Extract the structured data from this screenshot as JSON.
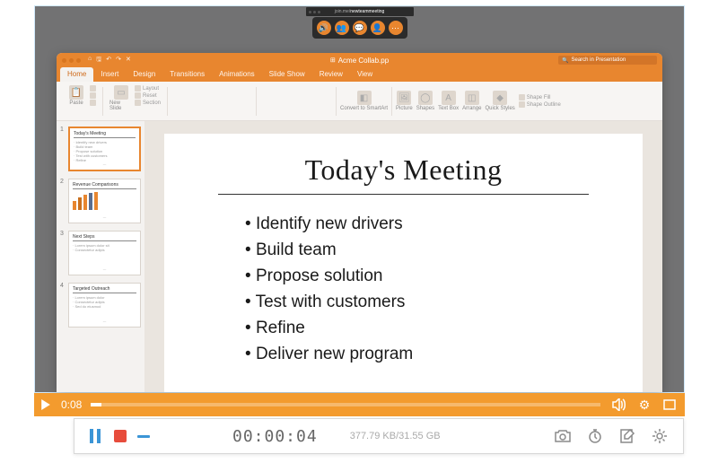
{
  "browser_url": {
    "prefix": "join.me/",
    "room": "newteammeeting"
  },
  "meeting_icons": [
    "volume",
    "participants",
    "chat",
    "person",
    "more"
  ],
  "presentation": {
    "document_title": "Acme Collab.pp",
    "search_placeholder": "Search in Presentation",
    "tabs": [
      "Home",
      "Insert",
      "Design",
      "Transitions",
      "Animations",
      "Slide Show",
      "Review",
      "View"
    ],
    "active_tab": 0,
    "ribbon": {
      "paste": "Paste",
      "new_slide": "New Slide",
      "layout": "Layout",
      "reset": "Reset",
      "section": "Section",
      "convert_to_smartart": "Convert to SmartArt",
      "picture": "Picture",
      "shapes": "Shapes",
      "text_box": "Text Box",
      "arrange": "Arrange",
      "quick_styles": "Quick Styles",
      "shape_fill": "Shape Fill",
      "shape_outline": "Shape Outline"
    },
    "thumbnails": [
      {
        "num": "1",
        "title": "Today's Meeting",
        "type": "bullets",
        "lines": [
          "Identify new drivers",
          "Build team",
          "Propose solution",
          "Test with customers",
          "Refine"
        ]
      },
      {
        "num": "2",
        "title": "Revenue Comparisons",
        "type": "chart"
      },
      {
        "num": "3",
        "title": "Next Steps",
        "type": "bullets",
        "lines": [
          "Lorem ipsum dolor sit",
          "Consectetur adipis"
        ]
      },
      {
        "num": "4",
        "title": "Targeted Outreach",
        "type": "bullets",
        "lines": [
          "Lorem ipsum dolor",
          "Consectetur adipis",
          "Sed do eiusmod"
        ]
      }
    ],
    "current_slide": {
      "title": "Today's Meeting",
      "bullets": [
        "Identify new drivers",
        "Build team",
        "Propose solution",
        "Test with customers",
        "Refine",
        "Deliver new program"
      ]
    }
  },
  "video_player": {
    "current_time": "0:08",
    "progress_percent": 2
  },
  "recorder": {
    "elapsed": "00:00:04",
    "size_text": "377.79 KB/31.55 GB"
  }
}
